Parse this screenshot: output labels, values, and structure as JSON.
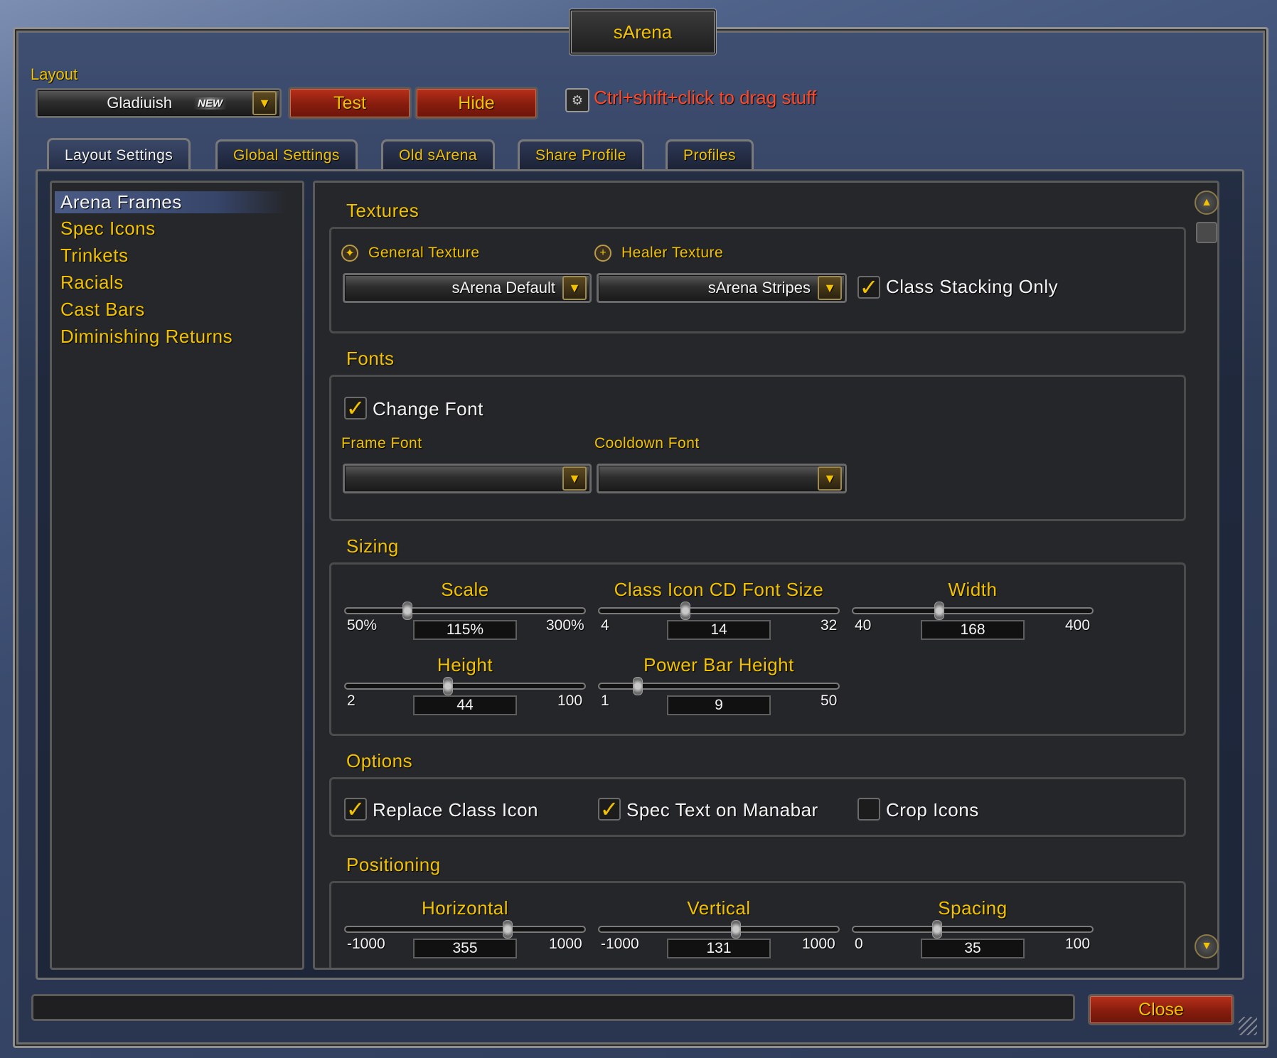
{
  "window": {
    "title": "sArena"
  },
  "header": {
    "layout_label": "Layout",
    "layout_select": {
      "value": "Gladiuish",
      "badge": "NEW"
    },
    "test_button": "Test",
    "hide_button": "Hide",
    "drag_hint": "Ctrl+shift+click to drag stuff"
  },
  "tabs": [
    {
      "label": "Layout Settings",
      "active": true
    },
    {
      "label": "Global Settings"
    },
    {
      "label": "Old sArena"
    },
    {
      "label": "Share Profile"
    },
    {
      "label": "Profiles"
    }
  ],
  "sidebar": {
    "items": [
      {
        "label": "Arena Frames",
        "selected": true
      },
      {
        "label": "Spec Icons"
      },
      {
        "label": "Trinkets"
      },
      {
        "label": "Racials"
      },
      {
        "label": "Cast Bars"
      },
      {
        "label": "Diminishing Returns"
      }
    ]
  },
  "textures": {
    "title": "Textures",
    "general_label": "General Texture",
    "general_value": "sArena Default",
    "healer_label": "Healer Texture",
    "healer_value": "sArena Stripes",
    "class_stacking": {
      "label": "Class Stacking Only",
      "checked": true
    }
  },
  "fonts": {
    "title": "Fonts",
    "change_font": {
      "label": "Change Font",
      "checked": true
    },
    "frame_font_label": "Frame Font",
    "frame_font_value": "",
    "cooldown_font_label": "Cooldown Font",
    "cooldown_font_value": ""
  },
  "sizing": {
    "title": "Sizing",
    "scale": {
      "label": "Scale",
      "min": "50%",
      "max": "300%",
      "value": "115%",
      "fraction": 0.26
    },
    "class_icon_cd_font": {
      "label": "Class Icon CD Font Size",
      "min": "4",
      "max": "32",
      "value": "14",
      "fraction": 0.36
    },
    "width": {
      "label": "Width",
      "min": "40",
      "max": "400",
      "value": "168",
      "fraction": 0.36
    },
    "height": {
      "label": "Height",
      "min": "2",
      "max": "100",
      "value": "44",
      "fraction": 0.43
    },
    "power_bar_height": {
      "label": "Power Bar Height",
      "min": "1",
      "max": "50",
      "value": "9",
      "fraction": 0.16
    }
  },
  "options": {
    "title": "Options",
    "replace_class_icon": {
      "label": "Replace Class Icon",
      "checked": true
    },
    "spec_text_on_manabar": {
      "label": "Spec Text on Manabar",
      "checked": true
    },
    "crop_icons": {
      "label": "Crop Icons",
      "checked": false
    }
  },
  "positioning": {
    "title": "Positioning",
    "horizontal": {
      "label": "Horizontal",
      "min": "-1000",
      "max": "1000",
      "value": "355",
      "fraction": 0.68
    },
    "vertical": {
      "label": "Vertical",
      "min": "-1000",
      "max": "1000",
      "value": "131",
      "fraction": 0.57
    },
    "spacing": {
      "label": "Spacing",
      "min": "0",
      "max": "100",
      "value": "35",
      "fraction": 0.35
    }
  },
  "footer": {
    "close_button": "Close"
  },
  "icons": {
    "dropdown_arrow": "dropdown-arrow-icon",
    "drag_hint": "gear-icon",
    "general_texture": "sword-icon",
    "healer_texture": "plus-icon",
    "check": "checkmark-icon",
    "scroll_up": "scroll-up-icon",
    "scroll_down": "scroll-down-icon"
  },
  "colors": {
    "gold_text": "#f2c200",
    "red_button": "#8a1e0f",
    "hint_text": "#ff4a2a",
    "selected_item": "#4a5b85"
  }
}
